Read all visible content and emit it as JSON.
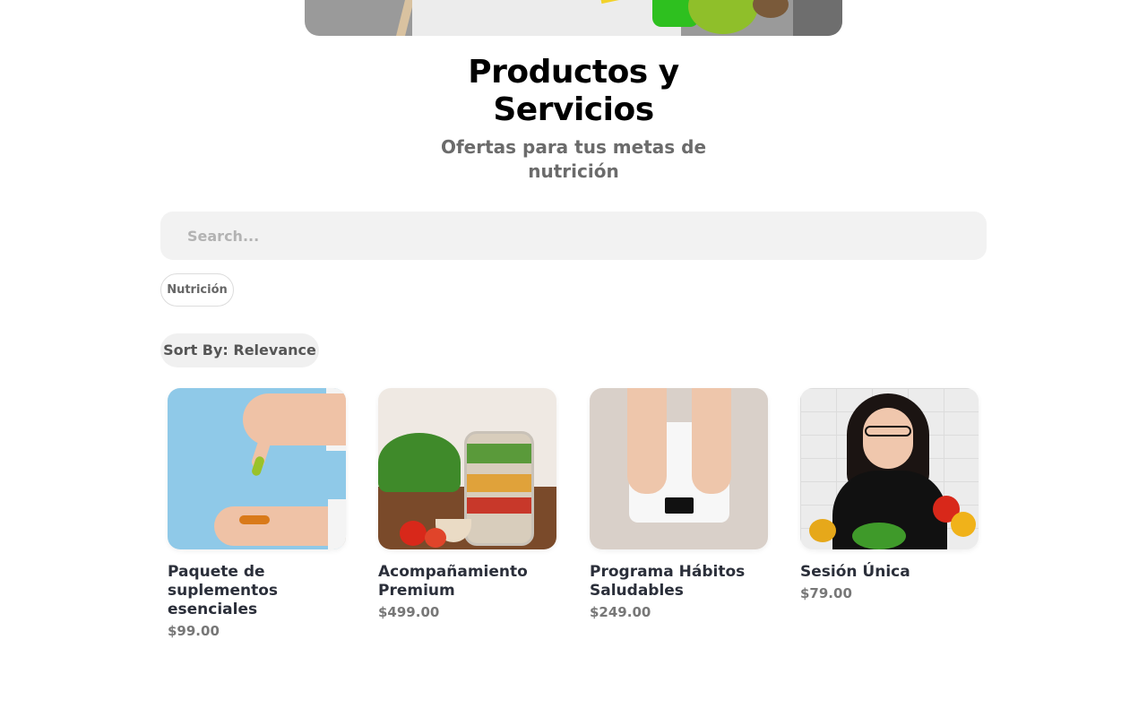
{
  "header": {
    "title": "Productos y Servicios",
    "subtitle": "Ofertas para tus metas de nutrición"
  },
  "search": {
    "placeholder": "Search..."
  },
  "filters": [
    {
      "label": "Nutrición"
    }
  ],
  "sort": {
    "label": "Sort By: Relevance"
  },
  "products": [
    {
      "name": "Paquete de suplementos esenciales",
      "price": "$99.00",
      "image": "supplements-capsules-hand-photo"
    },
    {
      "name": "Acompañamiento Premium",
      "price": "$499.00",
      "image": "salad-jar-photo"
    },
    {
      "name": "Programa Hábitos Saludables",
      "price": "$249.00",
      "image": "feet-on-scale-photo"
    },
    {
      "name": "Sesión Única",
      "price": "$79.00",
      "image": "woman-with-vegetables-photo"
    }
  ]
}
